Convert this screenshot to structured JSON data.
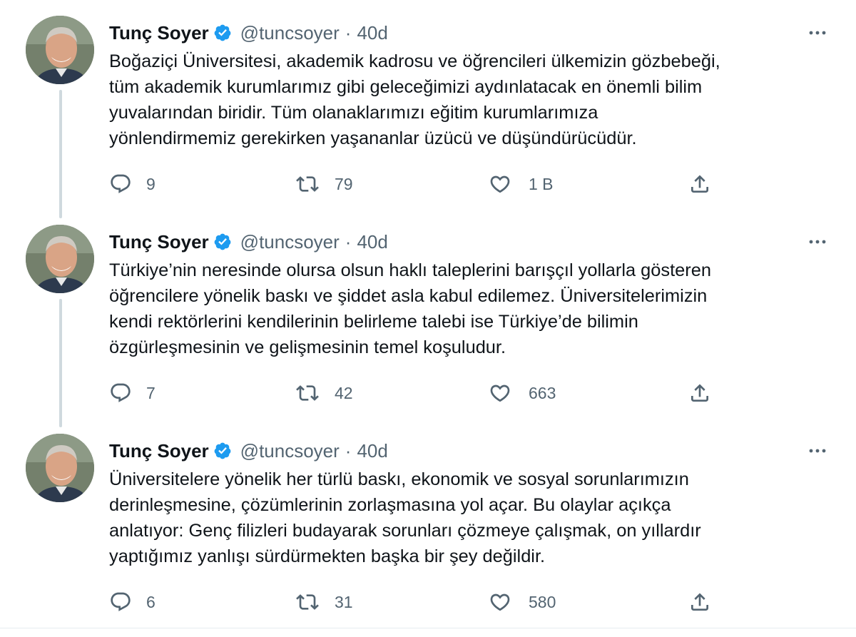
{
  "colors": {
    "accent": "#1d9bf0",
    "muted": "#536471",
    "text": "#0f1419",
    "thread_line": "#cfd9de"
  },
  "tweets": [
    {
      "author": {
        "name": "Tunç Soyer",
        "handle": "@tuncsoyer",
        "verified": true
      },
      "separator": "·",
      "time": "40d",
      "text": "Boğaziçi Üniversitesi, akademik kadrosu ve öğrencileri ülkemizin gözbebeği,\ntüm akademik kurumlarımız gibi geleceğimizi aydınlatacak en önemli bilim\nyuvalarından biridir. Tüm olanaklarımızı eğitim kurumlarımıza\nyönlendirmemiz gerekirken yaşananlar üzücü ve düşündürücüdür.",
      "replies": "9",
      "retweets": "79",
      "likes": "1 B"
    },
    {
      "author": {
        "name": "Tunç Soyer",
        "handle": "@tuncsoyer",
        "verified": true
      },
      "separator": "·",
      "time": "40d",
      "text": "Türkiye’nin neresinde olursa olsun haklı taleplerini barışçıl yollarla gösteren\nöğrencilere yönelik baskı ve şiddet asla kabul edilemez. Üniversitelerimizin\nkendi rektörlerini kendilerinin belirleme talebi ise Türkiye’de bilimin\nözgürleşmesinin ve gelişmesinin temel koşuludur.",
      "replies": "7",
      "retweets": "42",
      "likes": "663"
    },
    {
      "author": {
        "name": "Tunç Soyer",
        "handle": "@tuncsoyer",
        "verified": true
      },
      "separator": "·",
      "time": "40d",
      "text": "Üniversitelere yönelik her türlü baskı, ekonomik ve sosyal sorunlarımızın\nderinleşmesine, çözümlerinin zorlaşmasına yol açar. Bu olaylar açıkça\nanlatıyor: Genç filizleri budayarak sorunları çözmeye çalışmak, on yıllardır\nyaptığımız yanlışı sürdürmekten başka bir şey değildir.",
      "replies": "6",
      "retweets": "31",
      "likes": "580"
    }
  ],
  "icons": {
    "reply": "reply-icon",
    "retweet": "retweet-icon",
    "like": "heart-icon",
    "share": "share-icon",
    "more": "more-icon",
    "verified": "verified-badge-icon"
  }
}
